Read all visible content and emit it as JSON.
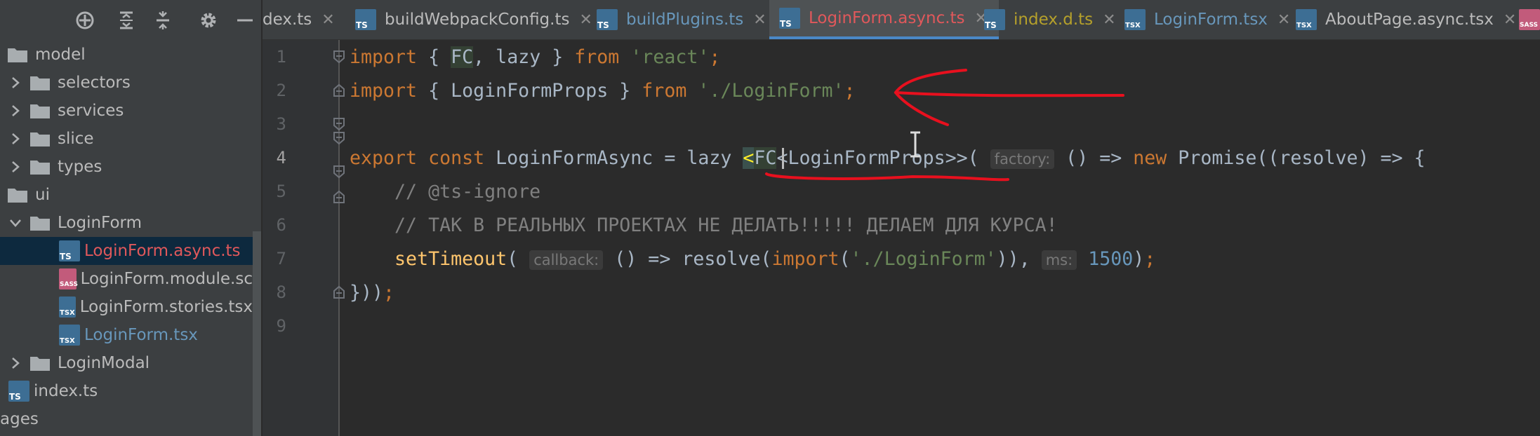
{
  "sidebar": {
    "toolbar": {
      "icons": [
        "crosshair-icon",
        "expand-all-icon",
        "collapse-all-icon",
        "gear-icon",
        "hide-icon"
      ]
    },
    "tree": [
      {
        "label": "model",
        "kind": "folder",
        "expanded": true
      },
      {
        "label": "selectors",
        "kind": "folder",
        "expanded": false
      },
      {
        "label": "services",
        "kind": "folder",
        "expanded": false
      },
      {
        "label": "slice",
        "kind": "folder",
        "expanded": false
      },
      {
        "label": "types",
        "kind": "folder",
        "expanded": false
      },
      {
        "label": "ui",
        "kind": "folder",
        "expanded": true
      },
      {
        "label": "LoginForm",
        "kind": "folder",
        "expanded": true
      },
      {
        "label": "LoginForm.async.ts",
        "kind": "file",
        "icon": "TS",
        "selected": true
      },
      {
        "label": "LoginForm.module.sc",
        "kind": "file",
        "icon": "SASS"
      },
      {
        "label": "LoginForm.stories.tsx",
        "kind": "file",
        "icon": "TSX"
      },
      {
        "label": "LoginForm.tsx",
        "kind": "file",
        "icon": "TSX"
      },
      {
        "label": "LoginModal",
        "kind": "folder",
        "expanded": false
      },
      {
        "label": "index.ts",
        "kind": "file",
        "icon": "TS"
      },
      {
        "label": "ages",
        "kind": "folder"
      }
    ]
  },
  "tabs": [
    {
      "label": "dex.ts",
      "icon": "",
      "close": "✕"
    },
    {
      "label": "buildWebpackConfig.ts",
      "icon": "TS",
      "close": "✕"
    },
    {
      "label": "buildPlugins.ts",
      "icon": "TS",
      "close": "✕"
    },
    {
      "label": "LoginForm.async.ts",
      "icon": "TS",
      "close": "✕",
      "active": true
    },
    {
      "label": "index.d.ts",
      "icon": "TS",
      "close": "✕"
    },
    {
      "label": "LoginForm.tsx",
      "icon": "TSX",
      "close": "✕"
    },
    {
      "label": "AboutPage.async.tsx",
      "icon": "TSX",
      "close": "✕"
    },
    {
      "label": "SASS",
      "icon": "SASS"
    }
  ],
  "editor": {
    "line_numbers": [
      "1",
      "2",
      "3",
      "4",
      "5",
      "6",
      "7",
      "8",
      "9"
    ],
    "line1": {
      "import": "import",
      "p1": " { ",
      "fc": "FC",
      "p2": ", lazy } ",
      "from": "from",
      "sp": " ",
      "str": "'react'",
      "semi": ";"
    },
    "line2": {
      "import": "import",
      "p1": " { LoginFormProps } ",
      "from": "from",
      "sp": " ",
      "str": "'./LoginForm'",
      "semi": ";"
    },
    "line4": {
      "export": "export",
      "sp1": " ",
      "const": "const",
      "p1": " LoginFormAsync = lazy ",
      "lt": "<",
      "fc": "FC",
      "generic": "<LoginFormProps>>(",
      "sp2": " ",
      "hint": "factory:",
      "p2": " () => ",
      "new": "new",
      "p3": " Promise((resolve) => {"
    },
    "line5": {
      "indent": "    ",
      "comment": "// @ts-ignore"
    },
    "line6": {
      "indent": "    ",
      "comment": "// ТАК В РЕАЛЬНЫХ ПРОЕКТАХ НЕ ДЕЛАТЬ!!!!! ДЕЛАЕМ ДЛЯ КУРСА!"
    },
    "line7": {
      "indent": "    ",
      "fn": "setTimeout",
      "p1": "( ",
      "hint1": "callback:",
      "p2": " () => resolve(",
      "import": "import",
      "p3": "(",
      "str": "'./LoginForm'",
      "p4": ")), ",
      "hint2": "ms:",
      "sp": " ",
      "num": "1500",
      "p5": ")",
      "semi": ";"
    },
    "line8": {
      "p1": "}))",
      "semi": ";"
    }
  },
  "colors": {
    "keyword": "#cc7832",
    "string": "#6a8759",
    "function": "#ffc66d",
    "number": "#6897bb",
    "comment": "#808080",
    "annotation": "#e8101e",
    "active_tab_accent": "#4a88c7"
  }
}
